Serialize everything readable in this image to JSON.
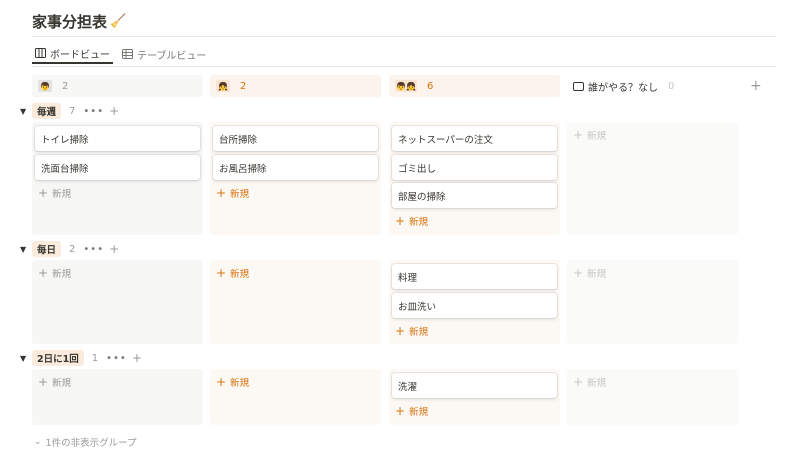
{
  "page": {
    "title": "家事分担表",
    "title_icon": "broom-icon"
  },
  "tabs": [
    {
      "label": "ボードビュー",
      "icon": "board-icon",
      "active": true
    },
    {
      "label": "テーブルビュー",
      "icon": "table-icon",
      "active": false
    }
  ],
  "columns": [
    {
      "avatar": "👦",
      "count": "2"
    },
    {
      "avatar": "👧",
      "count": "2"
    },
    {
      "avatar": "👦👧",
      "count": "6"
    },
    {
      "label": "誰がやる？なし",
      "count": "0",
      "icon": "inbox-icon"
    }
  ],
  "groups": [
    {
      "tag": "毎週",
      "count": "7",
      "cells": [
        {
          "cards": [
            "トイレ掃除",
            "洗面台掃除"
          ]
        },
        {
          "cards": [
            "台所掃除",
            "お風呂掃除"
          ]
        },
        {
          "cards": [
            "ネットスーパーの注文",
            "ゴミ出し",
            "部屋の掃除"
          ]
        },
        {
          "cards": []
        }
      ]
    },
    {
      "tag": "毎日",
      "count": "2",
      "cells": [
        {
          "cards": []
        },
        {
          "cards": []
        },
        {
          "cards": [
            "料理",
            "お皿洗い"
          ]
        },
        {
          "cards": []
        }
      ]
    },
    {
      "tag": "2日に1回",
      "count": "1",
      "cells": [
        {
          "cards": []
        },
        {
          "cards": []
        },
        {
          "cards": [
            "洗濯"
          ]
        },
        {
          "cards": []
        }
      ]
    }
  ],
  "labels": {
    "new": "新規",
    "more": "•••",
    "plus": "+",
    "hidden_groups": "1件の非表示グループ"
  },
  "colors": {
    "accent_orange": "#d9730d",
    "tag_bg": "#faebdd",
    "cell_gray": "#f7f7f5",
    "cell_orange": "#fcf8f4"
  }
}
